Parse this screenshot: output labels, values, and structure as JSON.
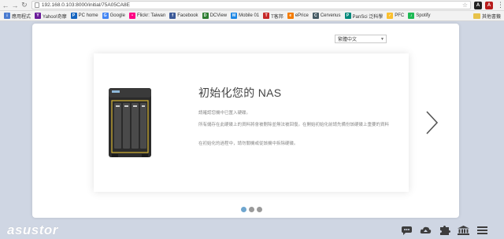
{
  "browser": {
    "url": "192.168.0.103:8000/initial/75A05CA8E",
    "bookmarks": [
      {
        "label": "應用程式",
        "color": "#4a7bd0",
        "glyph": "⋮"
      },
      {
        "label": "Yahoo!奇摩",
        "color": "#6a1b9a",
        "glyph": "Y"
      },
      {
        "label": "PC home",
        "color": "#1565c0",
        "glyph": "P"
      },
      {
        "label": "Google",
        "color": "#4285f4",
        "glyph": "G"
      },
      {
        "label": "Flickr: Taiwan",
        "color": "#ff0084",
        "glyph": "•"
      },
      {
        "label": "Facebook",
        "color": "#3b5998",
        "glyph": "f"
      },
      {
        "label": "DCView",
        "color": "#2e7d32",
        "glyph": "D"
      },
      {
        "label": "Mobile 01",
        "color": "#1e88e5",
        "glyph": "M"
      },
      {
        "label": "T客邦",
        "color": "#c62828",
        "glyph": "T"
      },
      {
        "label": "ePrice",
        "color": "#f57c00",
        "glyph": "e"
      },
      {
        "label": "Cervenus",
        "color": "#455a64",
        "glyph": "C"
      },
      {
        "label": "PanSci 泛科學",
        "color": "#00897b",
        "glyph": "P"
      },
      {
        "label": "PFC",
        "color": "#fbc02d",
        "glyph": "✓"
      },
      {
        "label": "Spotify",
        "color": "#1db954",
        "glyph": "♪"
      }
    ],
    "other_bookmarks": "其他書籤"
  },
  "language": {
    "selected": "繁體中文"
  },
  "slide": {
    "title": "初始化您的 NAS",
    "para1": "請確認您機中已置入硬碟。",
    "para2": "所有儲存在此硬碟上的資料將會被刪除並無法被回復。在開始初始化前請先備份該硬碟上重要的資料",
    "para3": "在初始化的過程中，請勿關機或從該機中拆除硬碟。"
  },
  "pagination": {
    "total": 3,
    "active": 0
  },
  "footer": {
    "logo": "asustor",
    "icons": [
      "chat-icon",
      "cloud-icon",
      "puzzle-icon",
      "bank-icon",
      "menu-icon"
    ]
  },
  "colors": {
    "accent": "#6fa6cf",
    "background": "#cfd6e3"
  }
}
